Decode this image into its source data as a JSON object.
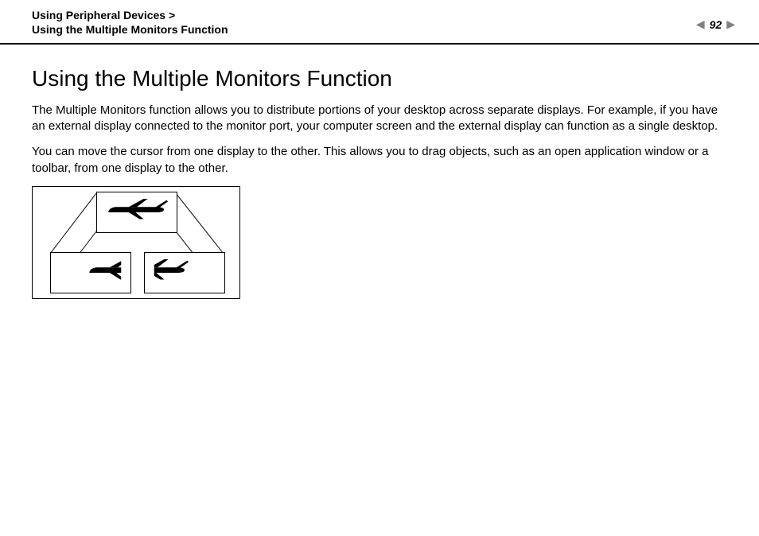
{
  "header": {
    "breadcrumb_line1": "Using Peripheral Devices >",
    "breadcrumb_line2": "Using the Multiple Monitors Function",
    "page_number": "92"
  },
  "content": {
    "title": "Using the Multiple Monitors Function",
    "paragraph1": "The Multiple Monitors function allows you to distribute portions of your desktop across separate displays. For example, if you have an external display connected to the monitor port, your computer screen and the external display can function as a single desktop.",
    "paragraph2": "You can move the cursor from one display to the other. This allows you to drag objects, such as an open application window or a toolbar, from one display to the other."
  },
  "icons": {
    "prev": "◀",
    "next": "▶"
  }
}
